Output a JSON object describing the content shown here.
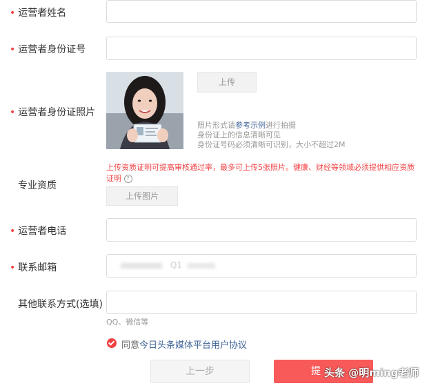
{
  "form": {
    "required_mark": "•",
    "name_label": "运营者姓名",
    "name_value": "",
    "id_label": "运营者身份证号",
    "id_value": "",
    "photo_label": "运营者身份证照片",
    "upload_label": "上传",
    "photo_hint_prefix": "照片形式请",
    "photo_hint_link": "参考示例",
    "photo_hint_suffix": "进行拍摄",
    "photo_hint_line2": "身份证上的信息清晰可见",
    "photo_hint_line3": "身份证号码必须清晰可识别，大小不超过2M",
    "qualification_label": "专业资质",
    "qualification_warning": "上传资质证明可提高审核通过率，最多可上传5张照片。健康、财经等领域必须提供相应资质证明",
    "help_icon_glyph": "?",
    "upload_image_label": "上传图片",
    "phone_label": "运营者电话",
    "phone_value": "",
    "email_label": "联系邮箱",
    "email_value": "Q1",
    "other_contact_label": "其他联系方式(选填)",
    "other_contact_value": "",
    "other_contact_hint": "QQ、微信等",
    "agree_prefix": "同意",
    "agree_link": "今日头条媒体平台用户协议",
    "prev_button": "上一步",
    "submit_button": "提",
    "watermark": "头条 @明ming老师"
  },
  "colors": {
    "required": "#f04142",
    "link": "#406599",
    "submit": "#f85959",
    "border": "#dcdcdc"
  }
}
